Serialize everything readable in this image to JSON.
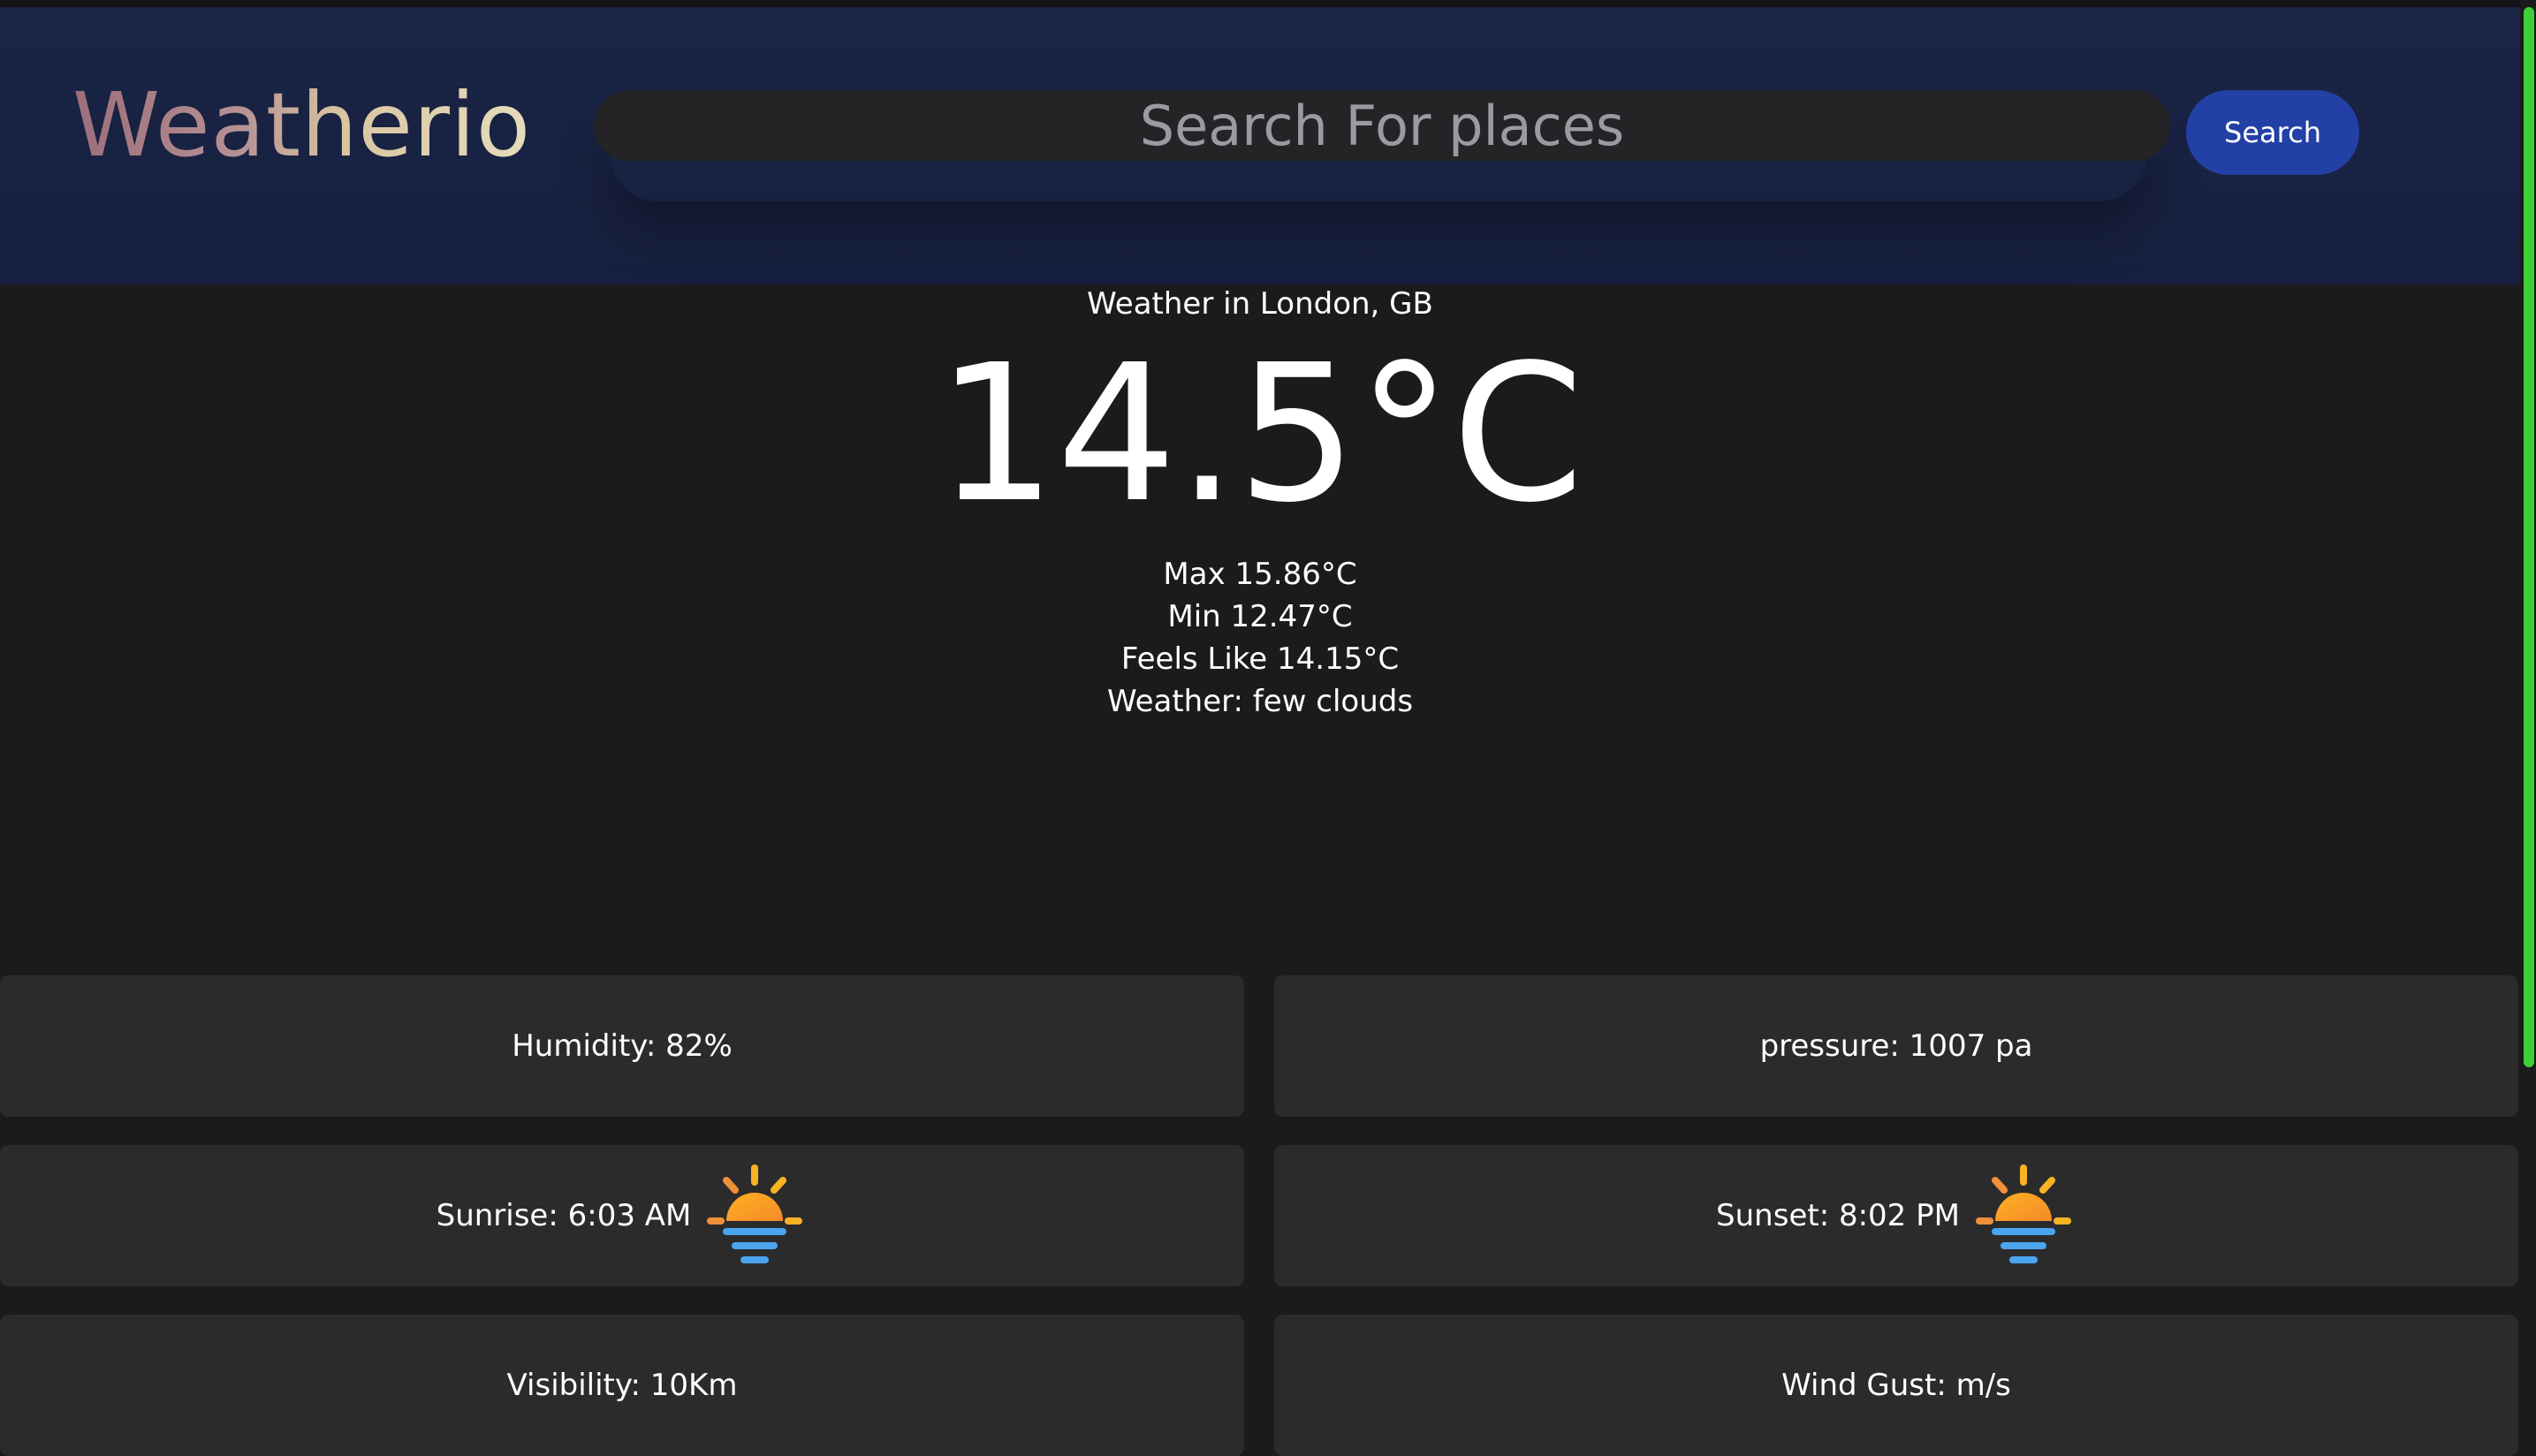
{
  "header": {
    "logo_text": "Weatherio",
    "search": {
      "placeholder": "Search For places",
      "button_label": "Search"
    }
  },
  "current": {
    "location_text": "Weather in London, GB",
    "temperature": "14.5°C",
    "max": "Max 15.86°C",
    "min": "Min 12.47°C",
    "feels_like": "Feels Like 14.15°C",
    "weather": "Weather: few clouds"
  },
  "cards": {
    "humidity": "Humidity: 82%",
    "pressure": "pressure: 1007 pa",
    "sunrise": "Sunrise: 6:03 AM",
    "sunset": "Sunset: 8:02 PM",
    "visibility": "Visibility: 10Km",
    "wind_gust": "Wind Gust: m/s"
  },
  "icons": {
    "sunrise_icon": "sunrise-icon",
    "sunset_icon": "sunset-icon"
  },
  "colors": {
    "page_background": "#1c1b1c",
    "header_background": "#1a2444",
    "card_background": "#2c2b2c",
    "search_button": "#2340a6",
    "scrollbar_thumb": "#3ecf36"
  }
}
